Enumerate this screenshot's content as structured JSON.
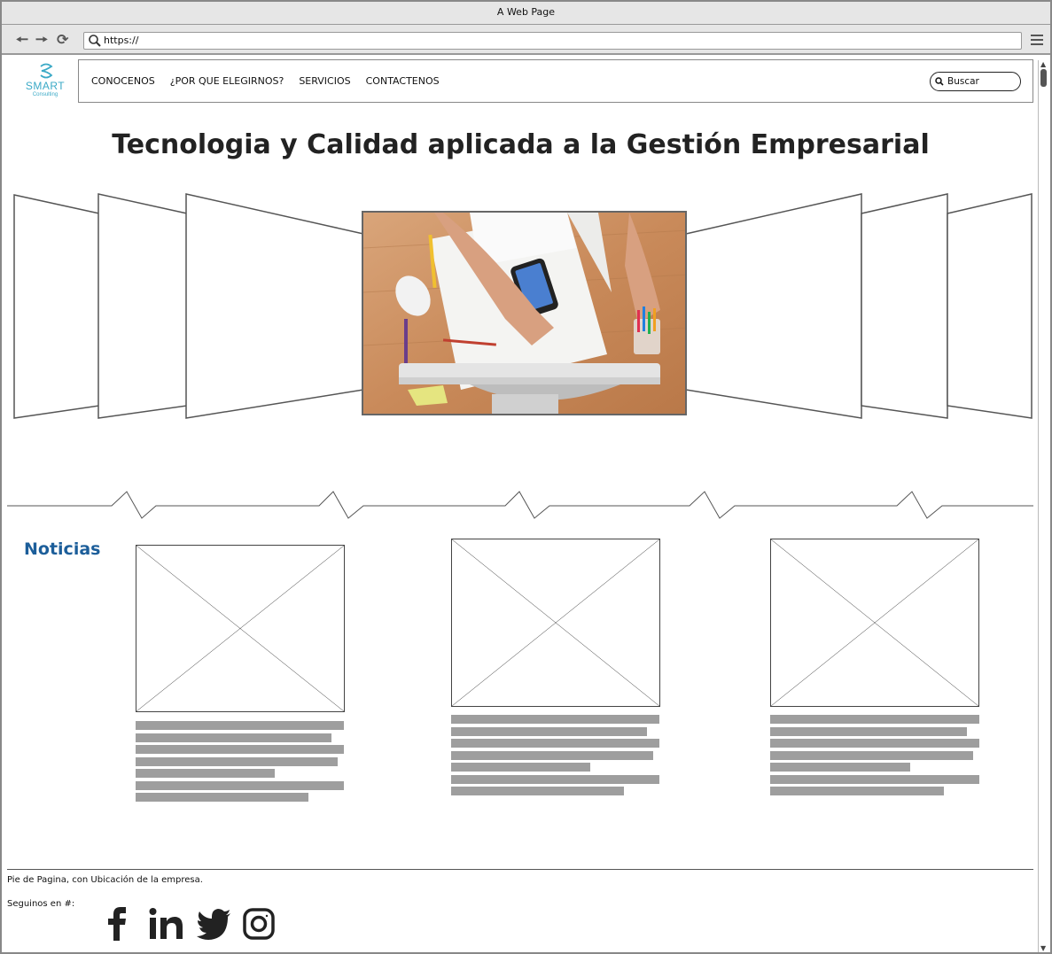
{
  "browser": {
    "window_title": "A Web Page",
    "url": "https://"
  },
  "logo": {
    "brand": "SMART",
    "sub": "Consulting"
  },
  "nav": {
    "items": [
      "CONOCENOS",
      "¿POR QUE ELEGIRNOS?",
      "SERVICIOS",
      "CONTACTENOS"
    ],
    "search_placeholder": "Buscar"
  },
  "hero": {
    "headline": "Tecnologia y Calidad aplicada a la Gestión Empresarial"
  },
  "news": {
    "title": "Noticias",
    "cards": [
      {
        "line_fractions": [
          1.0,
          0.94,
          1.0,
          0.97,
          0.67,
          1.0,
          0.83
        ]
      },
      {
        "line_fractions": [
          1.0,
          0.94,
          1.0,
          0.97,
          0.67,
          1.0,
          0.83
        ]
      },
      {
        "line_fractions": [
          1.0,
          0.94,
          1.0,
          0.97,
          0.67,
          1.0,
          0.83
        ]
      }
    ]
  },
  "footer": {
    "text": "Pie de Pagina, con Ubicación de la empresa.",
    "follow_label": "Seguinos en #:",
    "social_icons": [
      "facebook-icon",
      "linkedin-icon",
      "twitter-icon",
      "instagram-icon"
    ]
  },
  "colors": {
    "accent": "#1c5e9a",
    "logo": "#3aa9c6",
    "placeholder_text": "#9e9e9e"
  }
}
